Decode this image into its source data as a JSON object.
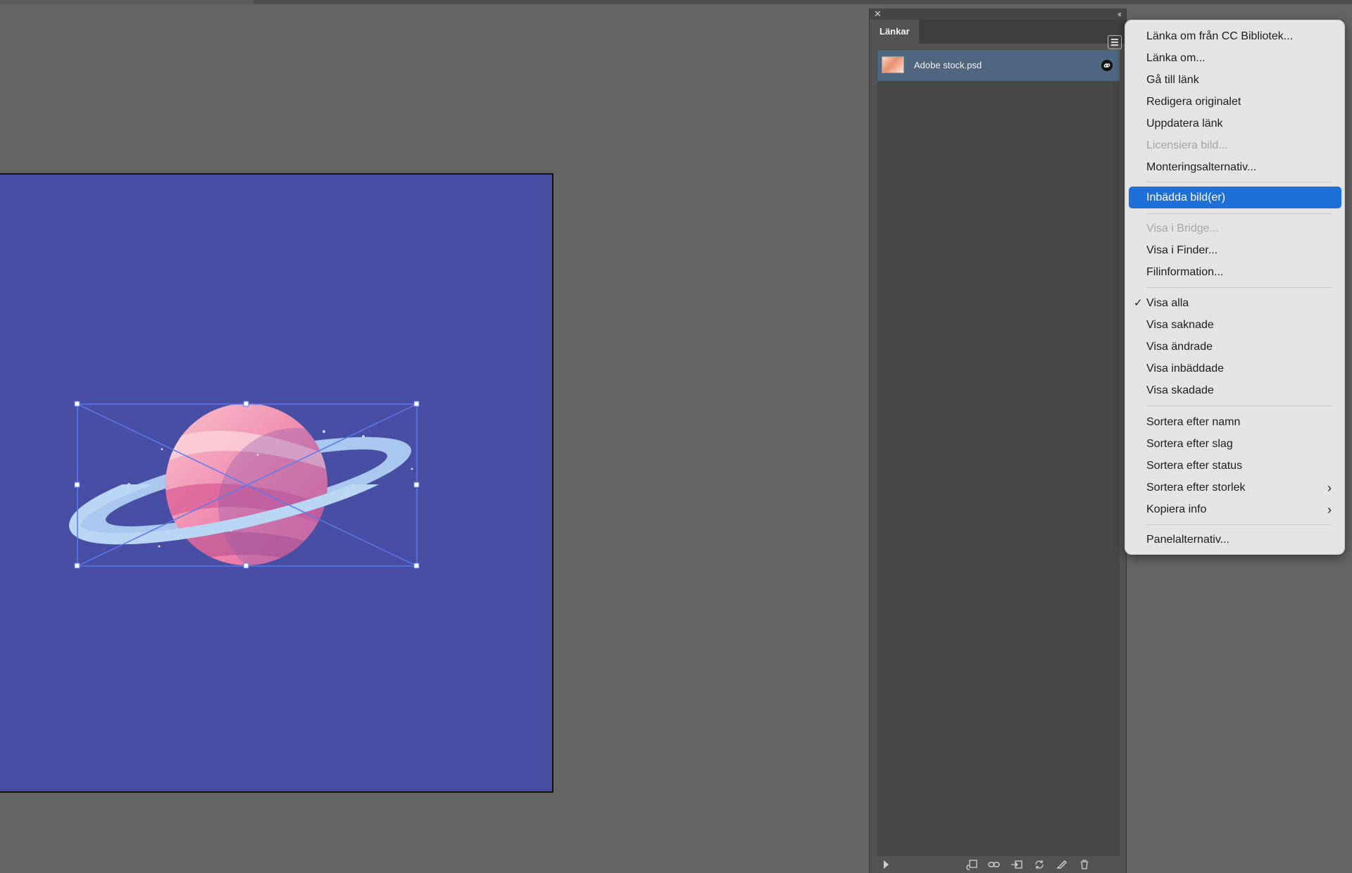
{
  "panel": {
    "tab_label": "Länkar",
    "links": [
      {
        "name": "Adobe stock.psd"
      }
    ]
  },
  "context_menu": {
    "items": [
      {
        "label": "Länka om från CC Bibliotek...",
        "enabled": true
      },
      {
        "label": "Länka om...",
        "enabled": true
      },
      {
        "label": "Gå till länk",
        "enabled": true
      },
      {
        "label": "Redigera originalet",
        "enabled": true
      },
      {
        "label": "Uppdatera länk",
        "enabled": true
      },
      {
        "label": "Licensiera bild...",
        "enabled": false
      },
      {
        "label": "Monteringsalternativ...",
        "enabled": true
      },
      {
        "label": "Inbädda bild(er)",
        "enabled": true,
        "highlighted": true
      },
      {
        "label": "Visa i Bridge...",
        "enabled": false
      },
      {
        "label": "Visa i Finder...",
        "enabled": true
      },
      {
        "label": "Filinformation...",
        "enabled": true
      },
      {
        "label": "Visa alla",
        "enabled": true,
        "checked": true
      },
      {
        "label": "Visa saknade",
        "enabled": true
      },
      {
        "label": "Visa ändrade",
        "enabled": true
      },
      {
        "label": "Visa inbäddade",
        "enabled": true
      },
      {
        "label": "Visa skadade",
        "enabled": true
      },
      {
        "label": "Sortera efter namn",
        "enabled": true
      },
      {
        "label": "Sortera efter slag",
        "enabled": true
      },
      {
        "label": "Sortera efter status",
        "enabled": true
      },
      {
        "label": "Sortera efter storlek",
        "enabled": true,
        "submenu": true
      },
      {
        "label": "Kopiera info",
        "enabled": true,
        "submenu": true
      },
      {
        "label": "Panelalternativ...",
        "enabled": true
      }
    ]
  },
  "colors": {
    "artboard": "#474ea3",
    "canvas_bg": "#646464",
    "menu_highlight": "#1f6fd8",
    "selected_row": "#4e6680",
    "selection_frame": "#5b78f0"
  }
}
